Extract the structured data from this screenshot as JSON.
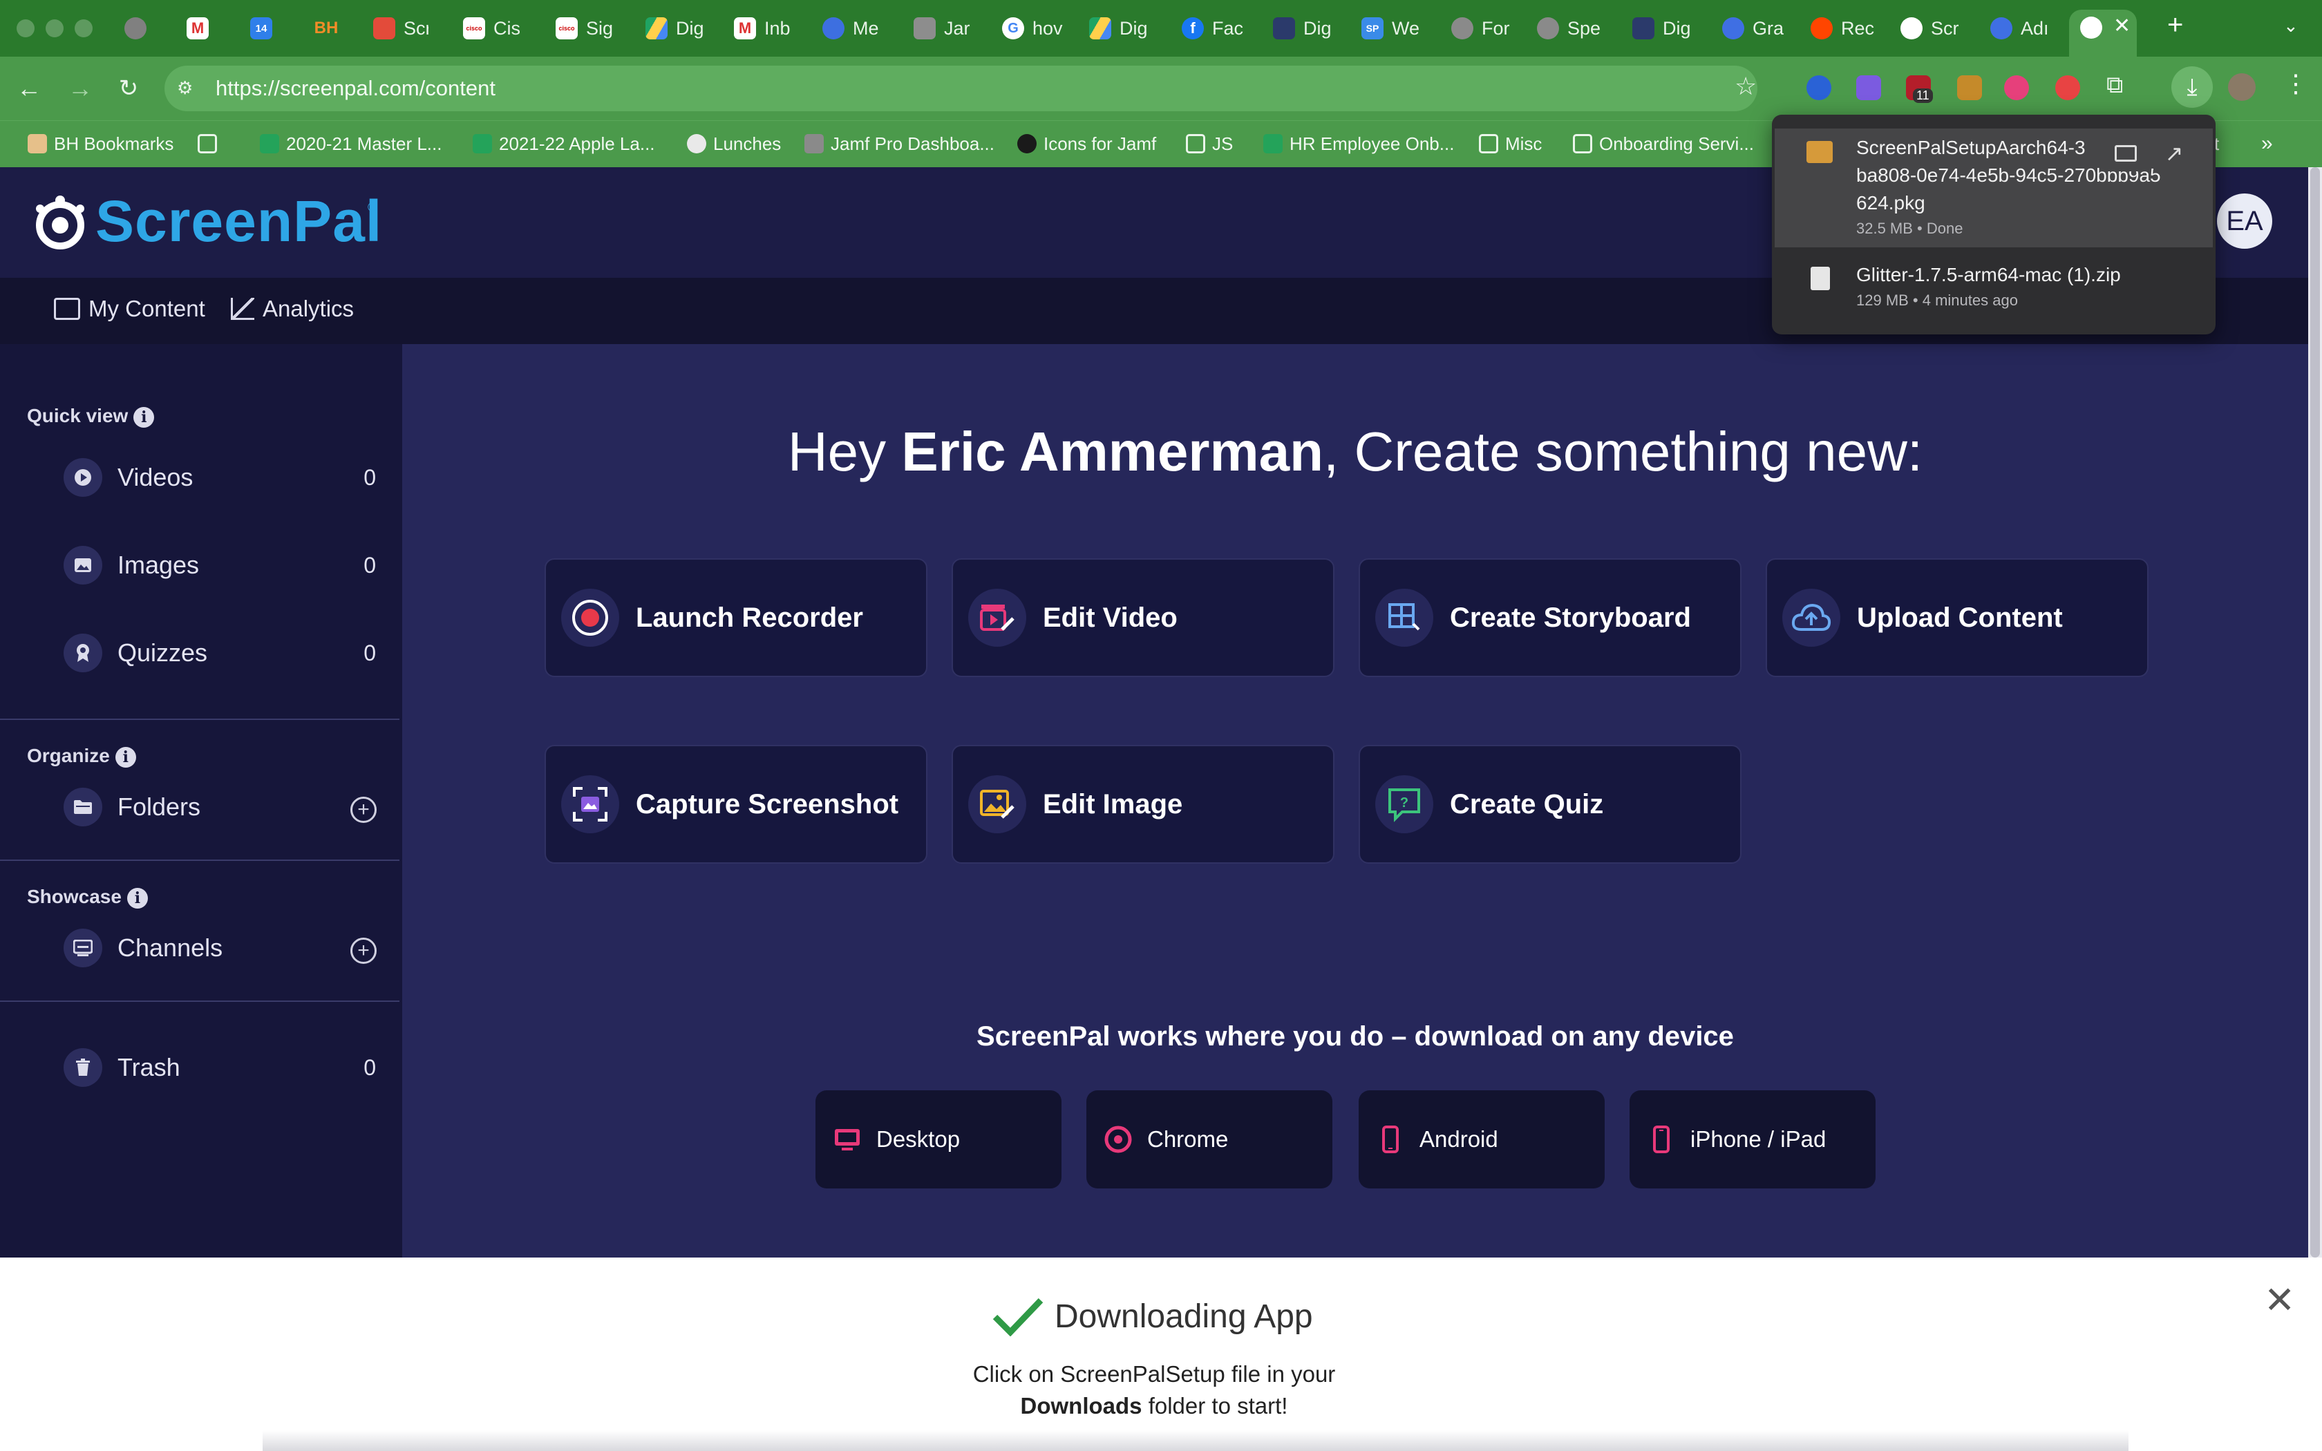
{
  "browser": {
    "tabs": [
      "Scr",
      "Cis",
      "Sig",
      "Dig",
      "Inb",
      "Me",
      "Jar",
      "hov",
      "Dig",
      "Fac",
      "Dig",
      "We",
      "For",
      "Spe",
      "Dig",
      "Gra",
      "Rec",
      "Scr",
      "Adı"
    ],
    "url": "https://screenpal.com/content",
    "extension_badge": "11",
    "bookmarks": [
      "BH Bookmarks",
      "2020-21 Master L...",
      "2021-22 Apple La...",
      "Lunches",
      "Jamf Pro Dashboa...",
      "Icons for Jamf",
      "JS",
      "HR Employee Onb...",
      "Misc",
      "Onboarding Servi..."
    ],
    "overflow_text": "t",
    "downloads": [
      {
        "name_lines": [
          "ScreenPalSetupAarch64-3",
          "ba808-0e74-4e5b-94c5-270bbb9a5",
          "624.pkg"
        ],
        "meta": "32.5 MB • Done"
      },
      {
        "name_lines": [
          "Glitter-1.7.5-arm64-mac (1).zip"
        ],
        "meta": "129 MB • 4 minutes ago"
      }
    ]
  },
  "app": {
    "logo": "ScreenPal",
    "avatar": "EA",
    "nav": [
      "My Content",
      "Analytics"
    ],
    "sidebar": {
      "quick_view": "Quick view",
      "items": [
        {
          "label": "Videos",
          "count": "0"
        },
        {
          "label": "Images",
          "count": "0"
        },
        {
          "label": "Quizzes",
          "count": "0"
        }
      ],
      "organize": "Organize",
      "folders": "Folders",
      "showcase": "Showcase",
      "channels": "Channels",
      "trash": "Trash",
      "trash_count": "0"
    },
    "greeting": {
      "pre": "Hey ",
      "name": "Eric Ammerman",
      "post": ", Create something new:"
    },
    "actions": [
      "Launch Recorder",
      "Edit Video",
      "Create Storyboard",
      "Upload Content",
      "Capture Screenshot",
      "Edit Image",
      "Create Quiz"
    ],
    "devices_title": "ScreenPal works where you do – download on any device",
    "devices": [
      "Desktop",
      "Chrome",
      "Android",
      "iPhone / iPad"
    ],
    "banner": {
      "title": "Downloading App",
      "line1": "Click on ScreenPalSetup file in your",
      "bold": "Downloads",
      "line2_rest": " folder to start!"
    }
  },
  "colors": {
    "chrome_green": "#4b9a4b",
    "app_bg": "#26275a",
    "accent_pink": "#e8397a",
    "accent_blue": "#2ea6e6"
  }
}
